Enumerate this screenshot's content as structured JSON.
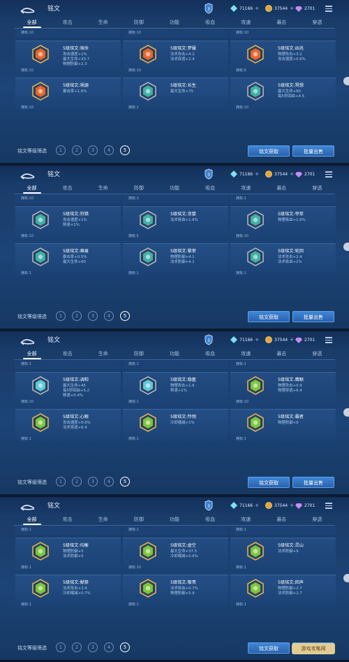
{
  "header": {
    "title": "铭文",
    "diamond": "71166",
    "gold": "37544",
    "gem": "2701"
  },
  "tabs": [
    "全部",
    "攻击",
    "生命",
    "防御",
    "功能",
    "吸血",
    "攻速",
    "暴击",
    "穿透"
  ],
  "footer": {
    "filter_label": "铭文等级筛选",
    "levels": [
      "1",
      "2",
      "3",
      "4",
      "5"
    ],
    "obtain_btn": "铭文获取",
    "sell_btn": "批量出售"
  },
  "colors": {
    "orange": "#e8662a",
    "teal": "#3fb0a8",
    "cyan": "#5cc9d8",
    "green": "#7cc63a",
    "gold_frame": "#d9b45a",
    "silver_frame": "#aab6c6"
  },
  "watermark": "游戏攻略网",
  "panels": [
    {
      "strip": {
        "owned": [
          "拥有:10",
          "拥有:10",
          "拥有:10"
        ],
        "stats": [
          [
            "",
            "",
            ""
          ]
        ]
      },
      "rows": [
        [
          {
            "name": "5级铭文:宿命",
            "stats": [
              "攻击速度+1%",
              "最大生命+33.7",
              "物理防御+2.3"
            ],
            "owned": "拥有:10",
            "icon": "orange-hex-icon",
            "color": "orange"
          },
          {
            "name": "5级铭文:梦魇",
            "stats": [
              "法术攻击+4.2",
              "法术穿透+2.4"
            ],
            "owned": "拥有:10",
            "icon": "orange-hex-icon",
            "color": "orange"
          },
          {
            "name": "5级铭文:凶兆",
            "stats": [
              "物理攻击+3.2",
              "攻击速度+0.6%"
            ],
            "owned": "拥有:6",
            "icon": "orange-hex-icon",
            "color": "orange"
          }
        ],
        [
          {
            "name": "5级铭文:祸源",
            "stats": [
              "暴击率+1.6%"
            ],
            "owned": "拥有:10",
            "icon": "orange-hex-icon",
            "color": "orange"
          },
          {
            "name": "5级铭文:长生",
            "stats": [
              "最大生命+75"
            ],
            "owned": "拥有:1",
            "icon": "teal-hex-icon",
            "color": "teal"
          },
          {
            "name": "5级铭文:冥想",
            "stats": [
              "最大生命+60",
              "每5秒回血+4.5"
            ],
            "owned": "拥有:10",
            "icon": "teal-hex-icon",
            "color": "teal"
          }
        ]
      ],
      "stripTexts": [
        "拥有:10",
        "拥有:10",
        "拥有:10"
      ]
    },
    {
      "rows": [
        [
          {
            "name": "5级铭文:狩猎",
            "stats": [
              "攻击速度+1%",
              "移速+1%"
            ],
            "owned": "拥有:10",
            "icon": "teal-hex-icon",
            "color": "teal"
          },
          {
            "name": "5级铭文:贪婪",
            "stats": [
              "法术吸血+1.6%"
            ],
            "owned": "拥有:5",
            "icon": "teal-hex-icon",
            "color": "teal"
          },
          {
            "name": "5级铭文:夺萃",
            "stats": [
              "物理吸血+1.6%"
            ],
            "owned": "拥有:10",
            "icon": "teal-hex-icon",
            "color": "teal"
          }
        ],
        [
          {
            "name": "5级铭文:兽痕",
            "stats": [
              "暴击率+0.5%",
              "最大生命+60"
            ],
            "owned": "拥有:1",
            "icon": "teal-hex-icon",
            "color": "teal"
          },
          {
            "name": "5级铭文:繁荣",
            "stats": [
              "物理防御+4.1",
              "法术防御+4.1"
            ],
            "owned": "拥有:1",
            "icon": "teal-hex-icon",
            "color": "teal"
          },
          {
            "name": "5级铭文:轮回",
            "stats": [
              "法术攻击+2.4",
              "法术吸血+1%"
            ],
            "owned": "拥有:1",
            "icon": "teal-hex-icon",
            "color": "teal"
          }
        ]
      ],
      "stripTexts": [
        "拥有:10",
        "拥有:1",
        "拥有:1"
      ]
    },
    {
      "rows": [
        [
          {
            "name": "5级铭文:调和",
            "stats": [
              "最大生命+45",
              "每5秒回血+5.2",
              "移速+0.4%"
            ],
            "owned": "拥有:10",
            "icon": "silver-hex-icon",
            "color": "cyan"
          },
          {
            "name": "5级铭文:隐匿",
            "stats": [
              "物理攻击+1.6",
              "移速+1%"
            ],
            "owned": "拥有:1",
            "icon": "silver-hex-icon",
            "color": "cyan"
          },
          {
            "name": "5级铭文:鹰眼",
            "stats": [
              "物理攻击+0.9",
              "物理穿透+6.4"
            ],
            "owned": "拥有:10",
            "icon": "green-hex-icon",
            "color": "green"
          }
        ],
        [
          {
            "name": "5级铭文:心眼",
            "stats": [
              "攻击速度+0.6%",
              "法术穿透+6.4"
            ],
            "owned": "拥有:1",
            "icon": "green-hex-icon",
            "color": "green"
          },
          {
            "name": "5级铭文:怜悯",
            "stats": [
              "冷却缩减+1%"
            ],
            "owned": "拥有:1",
            "icon": "green-hex-icon",
            "color": "green"
          },
          {
            "name": "5级铭文:霸者",
            "stats": [
              "物理防御+9"
            ],
            "owned": "拥有:1",
            "icon": "green-hex-icon",
            "color": "green"
          }
        ]
      ],
      "stripTexts": [
        "拥有:1",
        "拥有:1",
        "拥有:1"
      ]
    },
    {
      "rows": [
        [
          {
            "name": "5级铭文:均衡",
            "stats": [
              "物理防御+5",
              "法术防御+5"
            ],
            "owned": "拥有:1",
            "icon": "green-hex-icon",
            "color": "green"
          },
          {
            "name": "5级铭文:虚空",
            "stats": [
              "最大生命+37.5",
              "冷却缩减+0.6%"
            ],
            "owned": "拥有:10",
            "icon": "green-hex-icon",
            "color": "green"
          },
          {
            "name": "5级铭文:灵山",
            "stats": [
              "法术防御+9"
            ],
            "owned": "拥有:1",
            "icon": "green-hex-icon",
            "color": "green"
          }
        ],
        [
          {
            "name": "5级铭文:献祭",
            "stats": [
              "法术攻击+2.4",
              "冷却缩减+0.7%"
            ],
            "owned": "拥有:1",
            "icon": "green-hex-icon",
            "color": "green"
          },
          {
            "name": "5级铭文:敬畏",
            "stats": [
              "法术吸血+0.7%",
              "物理防御+5.9"
            ],
            "owned": "拥有:1",
            "icon": "green-hex-icon",
            "color": "green"
          },
          {
            "name": "5级铭文:回声",
            "stats": [
              "物理防御+2.7",
              "法术防御+2.7"
            ],
            "owned": "拥有:1",
            "icon": "green-hex-icon",
            "color": "green"
          }
        ]
      ],
      "stripTexts": [
        "拥有:1",
        "拥有:1",
        "拥有:1"
      ]
    }
  ]
}
